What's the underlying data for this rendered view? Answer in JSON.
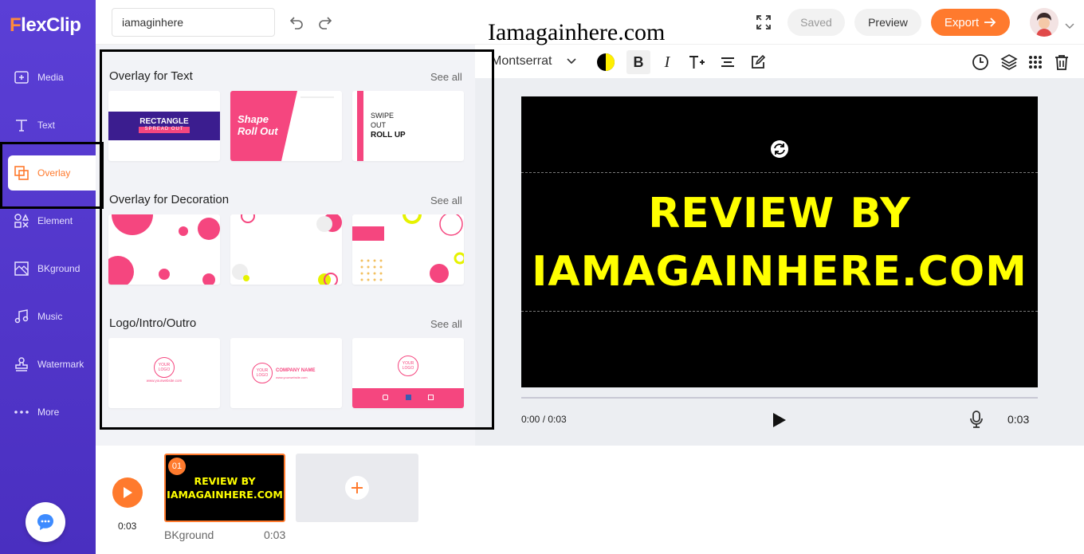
{
  "app": {
    "brand_prefix": "F",
    "brand_rest": "lexClip"
  },
  "sidebar": {
    "items": [
      {
        "label": "Media",
        "icon": "media-add-icon"
      },
      {
        "label": "Text",
        "icon": "text-icon"
      },
      {
        "label": "Overlay",
        "icon": "overlay-icon",
        "active": true
      },
      {
        "label": "Element",
        "icon": "element-icon"
      },
      {
        "label": "BKground",
        "icon": "background-icon"
      },
      {
        "label": "Music",
        "icon": "music-icon"
      },
      {
        "label": "Watermark",
        "icon": "stamp-icon"
      },
      {
        "label": "More",
        "icon": "more-dots-icon"
      }
    ]
  },
  "header": {
    "project_name": "iamaginhere",
    "saved_label": "Saved",
    "preview_label": "Preview",
    "export_label": "Export"
  },
  "watermark_text": "Iamagainhere.com",
  "panel": {
    "sections": [
      {
        "title": "Overlay for Text",
        "see_all": "See all",
        "cards": [
          {
            "line1": "RECTANGLE",
            "line2": "SPREAD OUT"
          },
          {
            "line1": "Shape",
            "line2": "Roll Out"
          },
          {
            "line1": "SWIPE",
            "line2": "OUT",
            "line3": "ROLL UP"
          }
        ]
      },
      {
        "title": "Overlay for Decoration",
        "see_all": "See all"
      },
      {
        "title": "Logo/Intro/Outro",
        "see_all": "See all",
        "cards": [
          {
            "logo1": "YOUR",
            "logo2": "LOGO",
            "url": "www.yourwebsite.com"
          },
          {
            "logo1": "YOUR",
            "logo2": "LOGO",
            "company": "COMPANY NAME",
            "url": "www.yourwebsite.com"
          },
          {
            "logo1": "YOUR",
            "logo2": "LOGO"
          }
        ]
      }
    ]
  },
  "toolbar": {
    "font": "Montserrat",
    "bold": "B",
    "italic": "I"
  },
  "canvas": {
    "line1": "REVIEW BY",
    "line2": "IAMAGAINHERE.COM"
  },
  "player": {
    "current": "0:00 / 0:03",
    "duration": "0:03"
  },
  "timeline": {
    "time": "0:03",
    "clip": {
      "number": "01",
      "line1": "REVIEW BY",
      "line2": "IAMAGAINHERE.COM",
      "label": "BKground",
      "duration": "0:03"
    }
  },
  "colors": {
    "accent": "#ff7a2d",
    "sidebar": "#5b3fd6",
    "pink": "#f5467f",
    "yellow": "#ffff00"
  }
}
